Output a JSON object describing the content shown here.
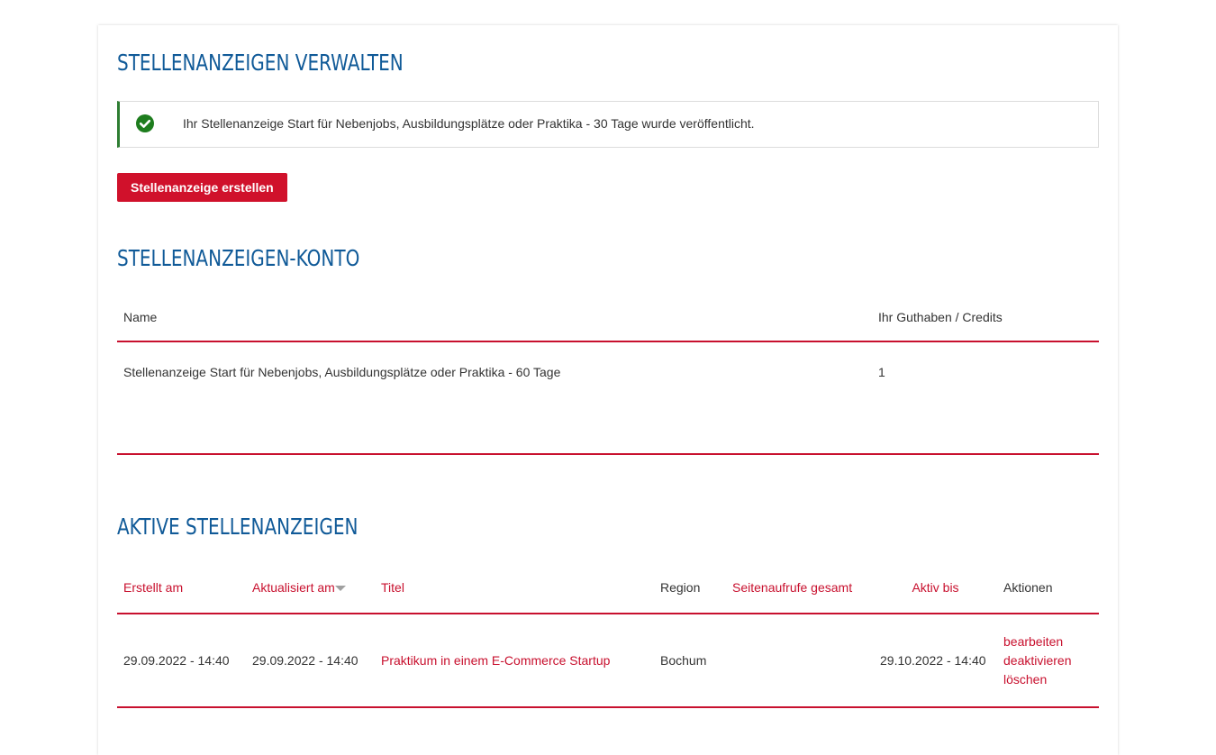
{
  "headings": {
    "manage": "STELLENANZEIGEN VERWALTEN",
    "account": "STELLENANZEIGEN-KONTO",
    "active": "AKTIVE STELLENANZEIGEN"
  },
  "alert": {
    "icon": "check-circle-icon",
    "text": "Ihr Stellenanzeige Start für Nebenjobs, Ausbildungsplätze oder Praktika - 30 Tage wurde veröffentlicht."
  },
  "create_button": "Stellenanzeige erstellen",
  "account_table": {
    "columns": [
      "Name",
      "Ihr Guthaben / Credits"
    ],
    "rows": [
      {
        "name": "Stellenanzeige Start für Nebenjobs, Ausbildungsplätze oder Praktika - 60 Tage",
        "credits": "1"
      }
    ]
  },
  "active_table": {
    "columns": {
      "created": "Erstellt am",
      "updated": "Aktualisiert am",
      "title": "Titel",
      "region": "Region",
      "views": "Seitenaufrufe gesamt",
      "active_until": "Aktiv bis",
      "actions": "Aktionen"
    },
    "rows": [
      {
        "created": "29.09.2022 - 14:40",
        "updated": "29.09.2022 - 14:40",
        "title": "Praktikum in einem E-Commerce Startup",
        "region": "Bochum",
        "views": "",
        "active_until": "29.10.2022 - 14:40",
        "actions": {
          "edit": "bearbeiten",
          "deactivate": "deaktivieren",
          "delete": "löschen"
        }
      }
    ]
  },
  "colors": {
    "heading": "#105a98",
    "accent": "#c8102e",
    "button": "#d0112b",
    "success": "#1e7d1e"
  }
}
